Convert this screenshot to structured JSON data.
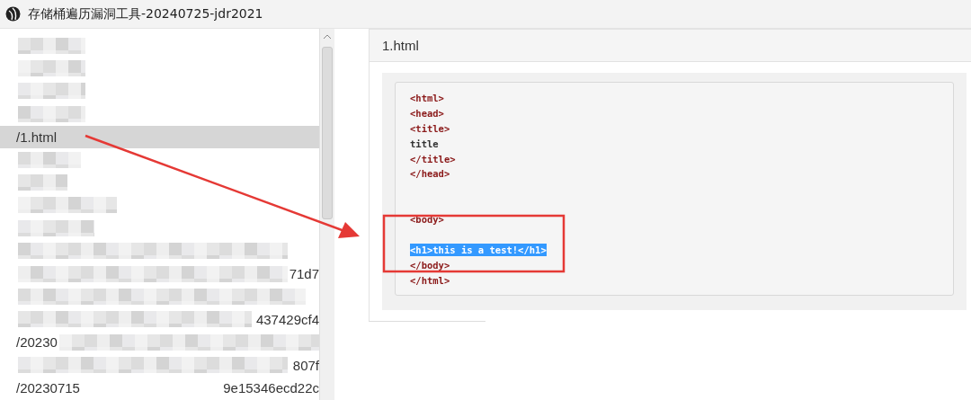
{
  "window": {
    "title": "存储桶遍历漏洞工具-20240725-jdr2021"
  },
  "file_list": {
    "items": [
      {
        "selected": false
      },
      {
        "selected": false
      },
      {
        "selected": false
      },
      {
        "selected": false
      },
      {
        "start": "/1.html",
        "selected": true
      },
      {
        "selected": false
      },
      {
        "selected": false
      },
      {
        "selected": false
      },
      {
        "selected": false
      },
      {
        "selected": false
      },
      {
        "end": "71d7",
        "selected": false
      },
      {
        "selected": false
      },
      {
        "end": "437429cf4",
        "selected": false
      },
      {
        "start": "/20230",
        "selected": false
      },
      {
        "end": "807f",
        "selected": false
      },
      {
        "start": "/20230715",
        "end": "9e15346ecd22c",
        "selected": false
      }
    ]
  },
  "preview": {
    "title": "1.html",
    "lines": [
      {
        "kind": "tag",
        "text": "<html>",
        "selected": false
      },
      {
        "kind": "tag",
        "text": "<head>",
        "selected": false
      },
      {
        "kind": "tag",
        "text": "<title>",
        "selected": false
      },
      {
        "kind": "text",
        "text": "title",
        "selected": false
      },
      {
        "kind": "tag",
        "text": "</title>",
        "selected": false
      },
      {
        "kind": "tag",
        "text": "</head>",
        "selected": false
      },
      {
        "kind": "blank"
      },
      {
        "kind": "blank"
      },
      {
        "kind": "tag",
        "text": "<body>",
        "selected": false
      },
      {
        "kind": "blank"
      },
      {
        "kind": "tag",
        "text": "<h1>this is a test!</h1>",
        "selected": true
      },
      {
        "kind": "tag",
        "text": "</body>",
        "selected": false
      },
      {
        "kind": "tag",
        "text": "</html>",
        "selected": false
      }
    ]
  }
}
